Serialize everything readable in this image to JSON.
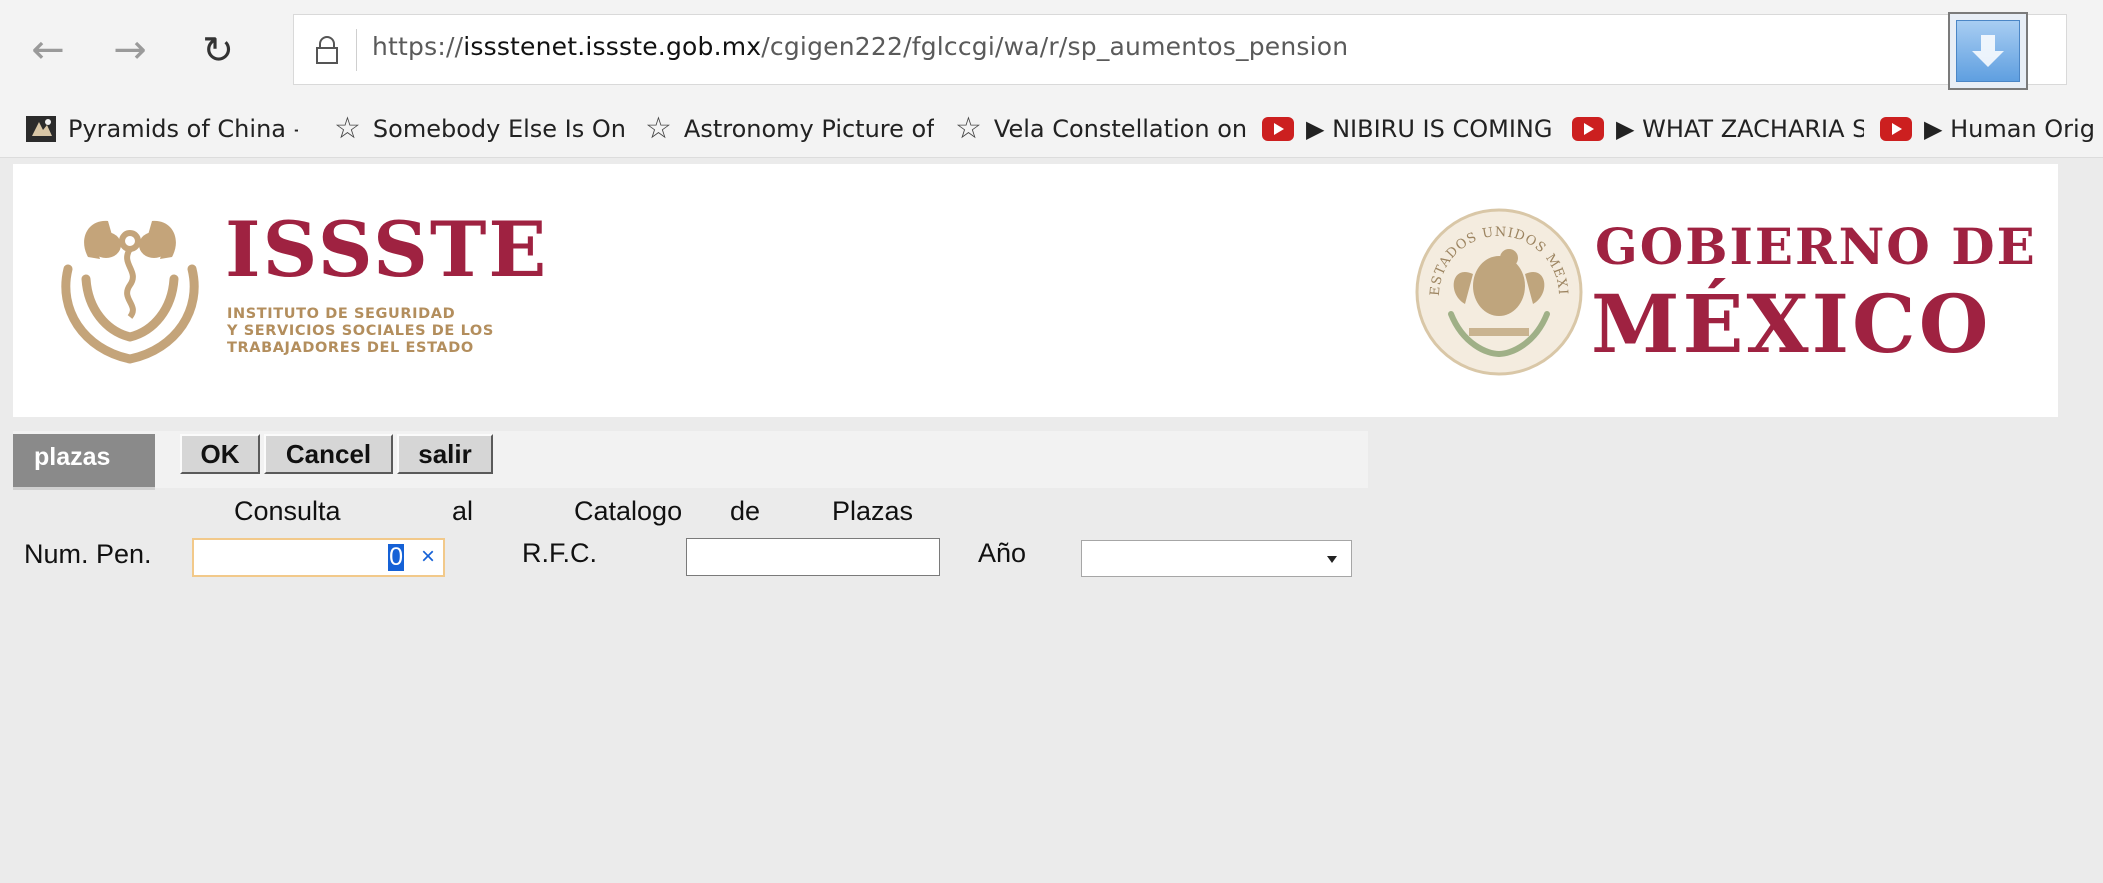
{
  "browser": {
    "url_prefix": "https://",
    "url_host": "issstenet.issste.gob.mx",
    "url_path": "/cgigen222/fglccgi/wa/r/sp_aumentos_pension",
    "bookmarks": [
      {
        "label": "Pyramids of China - A",
        "icon": "image-favicon"
      },
      {
        "label": "Somebody Else Is On",
        "icon": "star-icon"
      },
      {
        "label": "Astronomy Picture of",
        "icon": "star-icon"
      },
      {
        "label": "Vela Constellation on",
        "icon": "star-icon"
      },
      {
        "label": "▶ NIBIRU IS COMING",
        "icon": "youtube-icon"
      },
      {
        "label": "▶ WHAT ZACHARIA S",
        "icon": "youtube-icon"
      },
      {
        "label": "▶ Human Orig",
        "icon": "youtube-icon"
      }
    ]
  },
  "banner": {
    "issste_title": "ISSSTE",
    "issste_sub_1": "INSTITUTO DE SEGURIDAD",
    "issste_sub_2": "Y SERVICIOS SOCIALES DE LOS",
    "issste_sub_3": "TRABAJADORES DEL ESTADO",
    "gob_line1": "GOBIERNO DE",
    "gob_line2": "MÉXICO",
    "seal_text": "ESTADOS UNIDOS MEXICANOS",
    "colors": {
      "guinda": "#9f2241",
      "gold": "#b38e5d"
    }
  },
  "form": {
    "tab_label": "plazas",
    "ok_label": "OK",
    "cancel_label": "Cancel",
    "salir_label": "salir",
    "title_words": [
      "Consulta",
      "al",
      "Catalogo",
      "de",
      "Plazas"
    ],
    "num_pen_label": "Num. Pen.",
    "num_pen_value": "0",
    "rfc_label": "R.F.C.",
    "rfc_value": "",
    "ano_label": "Año",
    "ano_value": ""
  }
}
